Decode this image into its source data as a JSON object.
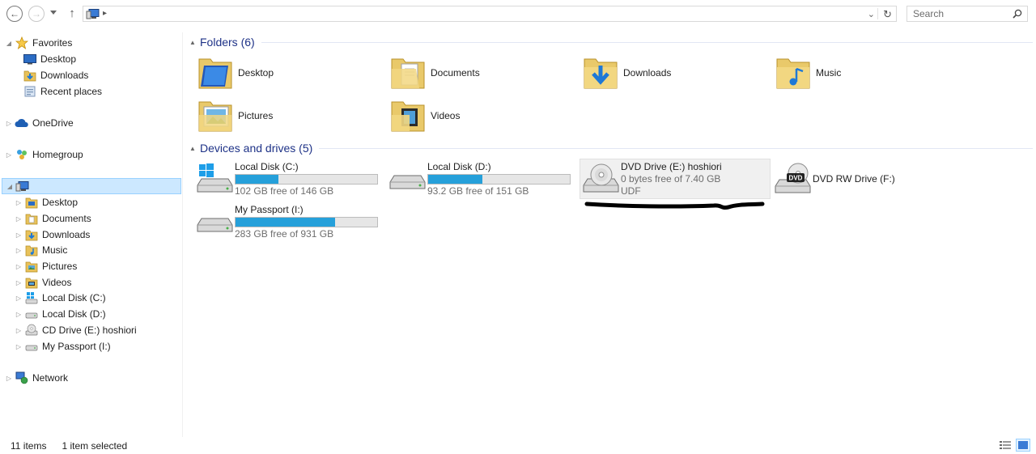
{
  "navigation": {
    "back_icon": "back-arrow-icon",
    "forward_icon": "forward-arrow-icon",
    "recent_icon": "chevron-down-icon",
    "up_icon": "up-arrow-icon",
    "address_icon": "computer-icon",
    "search_placeholder": "Search"
  },
  "tree": {
    "favorites": {
      "label": "Favorites",
      "children": [
        "Desktop",
        "Downloads",
        "Recent places"
      ]
    },
    "onedrive": "OneDrive",
    "homegroup": "Homegroup",
    "computer_children": [
      "Desktop",
      "Documents",
      "Downloads",
      "Music",
      "Pictures",
      "Videos",
      "Local Disk (C:)",
      "Local Disk (D:)",
      "CD Drive (E:) hoshiori",
      "My Passport (I:)"
    ],
    "network": "Network"
  },
  "folders_group": {
    "title": "Folders (6)",
    "items": [
      "Desktop",
      "Documents",
      "Downloads",
      "Music",
      "Pictures",
      "Videos"
    ]
  },
  "drives_group": {
    "title": "Devices and drives (5)",
    "items": [
      {
        "name": "Local Disk (C:)",
        "free": "102 GB free of 146 GB",
        "used_fraction": 0.3
      },
      {
        "name": "Local Disk (D:)",
        "free": "93.2 GB free of 151 GB",
        "used_fraction": 0.38
      },
      {
        "name": "DVD Drive (E:) hoshiori",
        "free": "0 bytes free of 7.40 GB",
        "filesystem": "UDF"
      },
      {
        "name": "DVD RW Drive (F:)"
      },
      {
        "name": "My Passport (I:)",
        "free": "283 GB free of 931 GB",
        "used_fraction": 0.7
      }
    ]
  },
  "status": {
    "items": "11 items",
    "selected": "1 item selected"
  },
  "colors": {
    "accent": "#26a0da",
    "selection": "#cce8ff",
    "group_title": "#1e3287"
  }
}
